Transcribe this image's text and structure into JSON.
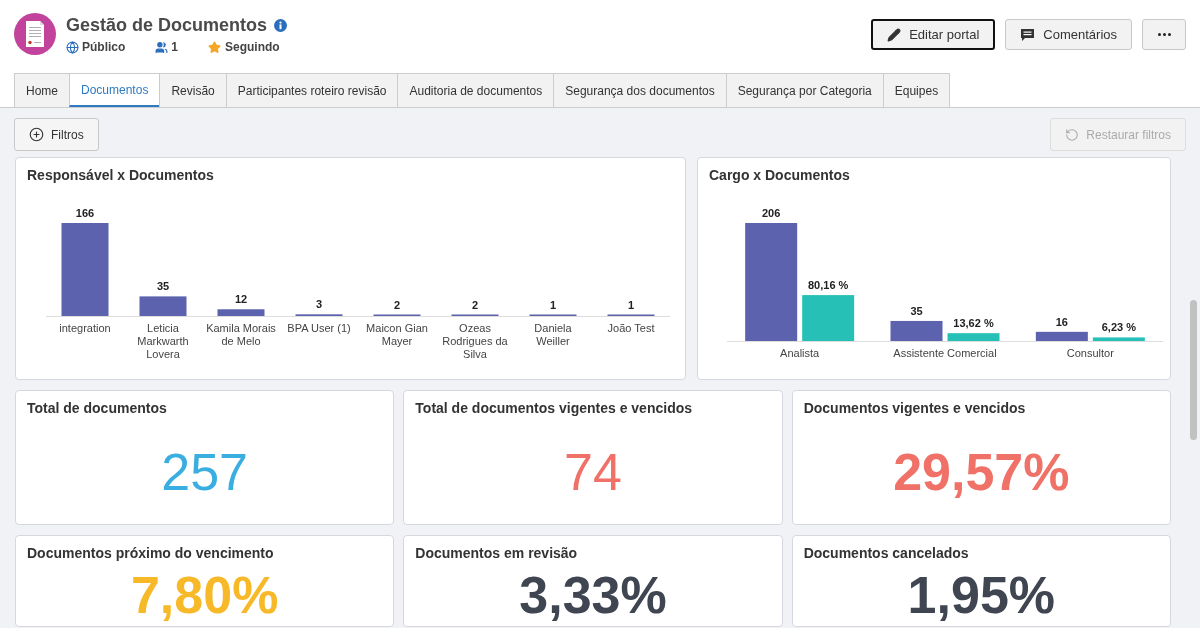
{
  "header": {
    "title": "Gestão de Documentos",
    "visibility": "Público",
    "members": "1",
    "follow": "Seguindo"
  },
  "actions": [
    {
      "kind": "edit",
      "label": "Editar portal",
      "focused": true
    },
    {
      "kind": "comments",
      "label": "Comentários",
      "focused": false
    },
    {
      "kind": "more",
      "focused": false
    }
  ],
  "tabs": [
    {
      "label": "Home",
      "selected": false
    },
    {
      "label": "Documentos",
      "selected": true
    },
    {
      "label": "Revisão",
      "selected": false
    },
    {
      "label": "Participantes roteiro revisão",
      "selected": false
    },
    {
      "label": "Auditoria de documentos",
      "selected": false
    },
    {
      "label": "Segurança dos documentos",
      "selected": false
    },
    {
      "label": "Segurança por Categoria",
      "selected": false
    },
    {
      "label": "Equipes",
      "selected": false
    }
  ],
  "filters": {
    "add": {
      "label": "Filtros",
      "disabled": false
    },
    "reset": {
      "label": "Restaurar filtros",
      "disabled": true
    }
  },
  "charts": [
    {
      "title": "Responsável x Documentos",
      "chart_data": {
        "type": "bar",
        "categories": [
          "integration",
          "Leticia Markwarth Lovera",
          "Kamila Morais de Melo",
          "BPA User (1)",
          "Maicon Gian Mayer",
          "Ozeas Rodrigues da Silva",
          "Daniela Weiller",
          "João Test"
        ],
        "series": [
          {
            "color": "#5c62ad",
            "values": [
              166,
              35,
              12,
              3,
              2,
              2,
              1,
              1
            ],
            "value_labels": [
              "166",
              "35",
              "12",
              "3",
              "2",
              "2",
              "1",
              "1"
            ]
          }
        ]
      }
    },
    {
      "title": "Cargo x Documentos",
      "chart_data": {
        "type": "bar",
        "categories": [
          "Analista",
          "Assistente Comercial",
          "Consultor"
        ],
        "series": [
          {
            "color": "#5c62ad",
            "values": [
              206,
              35,
              16
            ],
            "value_labels": [
              "206",
              "35",
              "16"
            ]
          },
          {
            "color": "#26c0b7",
            "values": [
              80.16,
              13.62,
              6.23
            ],
            "value_labels": [
              "80,16 %",
              "13,62 %",
              "6,23 %"
            ]
          }
        ]
      }
    }
  ],
  "kpis": [
    {
      "title": "Total de documentos",
      "value": "257",
      "color": "#3aaee0",
      "kind": "count"
    },
    {
      "title": "Total de documentos vigentes e vencidos",
      "value": "74",
      "color": "#f07167",
      "kind": "count"
    },
    {
      "title": "Documentos vigentes e vencidos",
      "value": "29,57%",
      "color": "#f07167",
      "kind": "percent"
    },
    {
      "title": "Documentos próximo do vencimento",
      "value": "7,80%",
      "color": "#f7b928",
      "kind": "percent"
    },
    {
      "title": "Documentos em revisão",
      "value": "3,33%",
      "color": "#3f4551",
      "kind": "percent"
    },
    {
      "title": "Documentos cancelados",
      "value": "1,95%",
      "color": "#3f4551",
      "kind": "percent"
    }
  ]
}
